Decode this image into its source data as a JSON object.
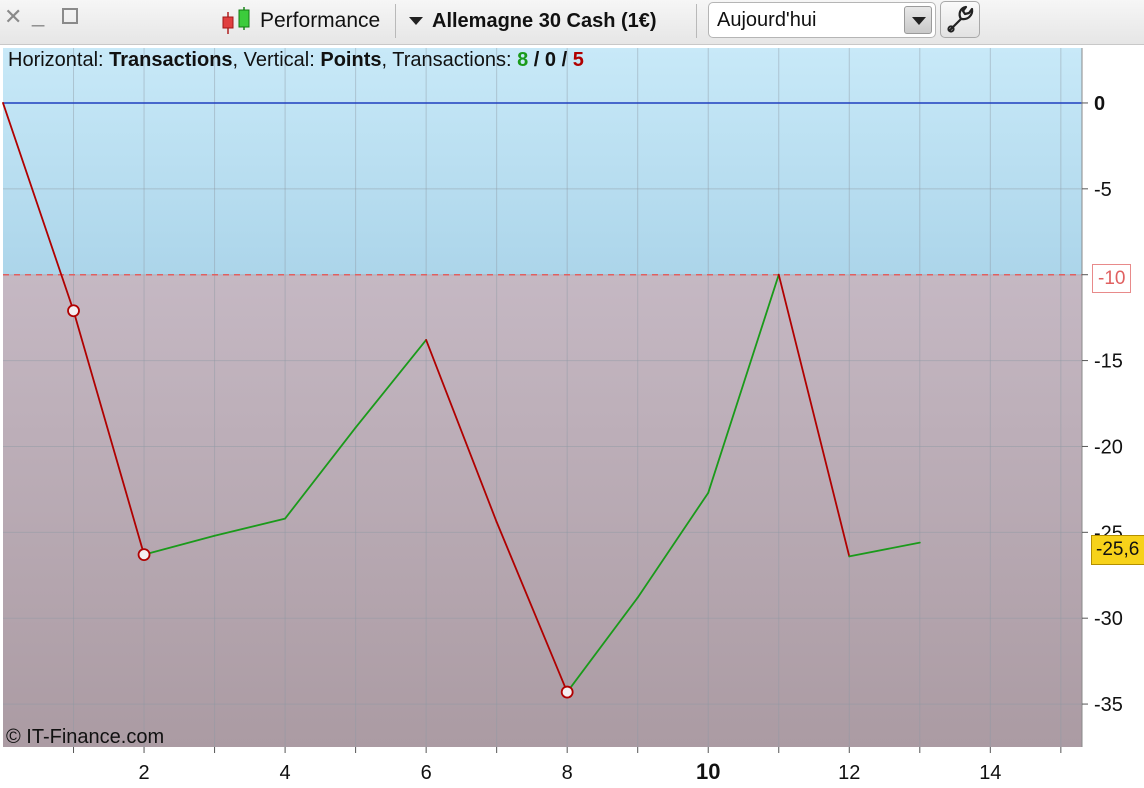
{
  "toolbar": {
    "close_icon": "close-icon",
    "minimize_icon": "minimize-icon",
    "maximize_icon": "maximize-icon",
    "performance_label": "Performance",
    "instrument_label": "Allemagne 30 Cash (1€)",
    "period_value": "Aujourd'hui",
    "wrench_icon": "wrench-icon"
  },
  "legend": {
    "h_prefix": "Horizontal: ",
    "h_value": "Transactions",
    "v_prefix": ", Vertical: ",
    "v_value": "Points",
    "t_prefix": ", Transactions: ",
    "wins": "8",
    "sep1": " / ",
    "neutral": "0",
    "sep2": " / ",
    "losses": "5"
  },
  "copyright": "© IT-Finance.com",
  "badges": {
    "last_value": "-25,6",
    "threshold_value": "-10"
  },
  "colors": {
    "gain": "#1a9a1a",
    "loss": "#b00000",
    "zero_line": "#1f3fbf",
    "threshold": "#e06060",
    "bg_top": "#c4e6f6",
    "bg_bottom": "#ad9ea6",
    "last_badge": "#f7d21a"
  },
  "chart_data": {
    "type": "line",
    "xlabel": "",
    "ylabel": "",
    "xlim": [
      0,
      15.3
    ],
    "ylim": [
      -37.5,
      3.2
    ],
    "x_ticks": [
      2,
      4,
      6,
      8,
      10,
      12,
      14
    ],
    "x_tick_labels": [
      "2",
      "4",
      "6",
      "8",
      "10",
      "12",
      "14"
    ],
    "x_tick_bold": "10",
    "y_ticks": [
      0,
      -5,
      -10,
      -15,
      -20,
      -25,
      -30,
      -35
    ],
    "y_tick_labels": [
      "0",
      "-5",
      "-10",
      "-15",
      "-20",
      "-25",
      "-30",
      "-35"
    ],
    "grid": true,
    "x": [
      0,
      1,
      2,
      3,
      4,
      5,
      6,
      7,
      8,
      9,
      10,
      11,
      12,
      13
    ],
    "y": [
      0,
      -12.1,
      -26.3,
      -25.2,
      -24.2,
      -18.9,
      -13.8,
      -24.4,
      -34.3,
      -28.8,
      -22.7,
      -10.0,
      -26.4,
      -25.6
    ],
    "segment_result": [
      "loss",
      "loss",
      "gain",
      "gain",
      "gain",
      "gain",
      "loss",
      "loss",
      "gain",
      "gain",
      "gain",
      "loss",
      "gain"
    ],
    "markers_at": [
      1,
      2,
      8
    ],
    "reference_lines": [
      {
        "y": 0,
        "style": "solid"
      },
      {
        "y": -10,
        "style": "dashed"
      }
    ],
    "last_value": -25.6
  }
}
